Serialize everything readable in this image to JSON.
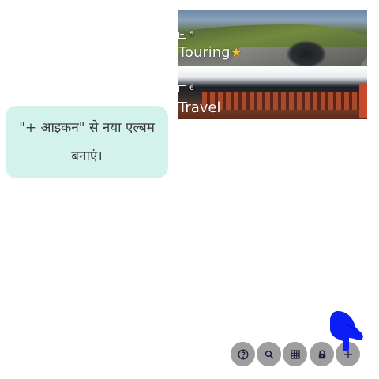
{
  "albums": [
    {
      "title": "Touring",
      "title_icon": "star-icon",
      "count": "5"
    },
    {
      "title": "Travel",
      "count": "6"
    }
  ],
  "hint": {
    "text": "\"+ आइकन\" से नया एल्बम बनाएं।"
  },
  "toolbar": {
    "buttons": [
      {
        "name": "help",
        "icon": "help-icon"
      },
      {
        "name": "search",
        "icon": "search-icon"
      },
      {
        "name": "grid",
        "icon": "grid-icon"
      },
      {
        "name": "lock",
        "icon": "lock-icon"
      },
      {
        "name": "add",
        "icon": "plus-icon"
      }
    ]
  },
  "colors": {
    "hint_background": "#d4f2ec",
    "toolbar_button": "#9e9e9e",
    "icon": "#1f1a3a",
    "hand_pointer": "#0a1ef5",
    "star": "#f7c52b"
  }
}
